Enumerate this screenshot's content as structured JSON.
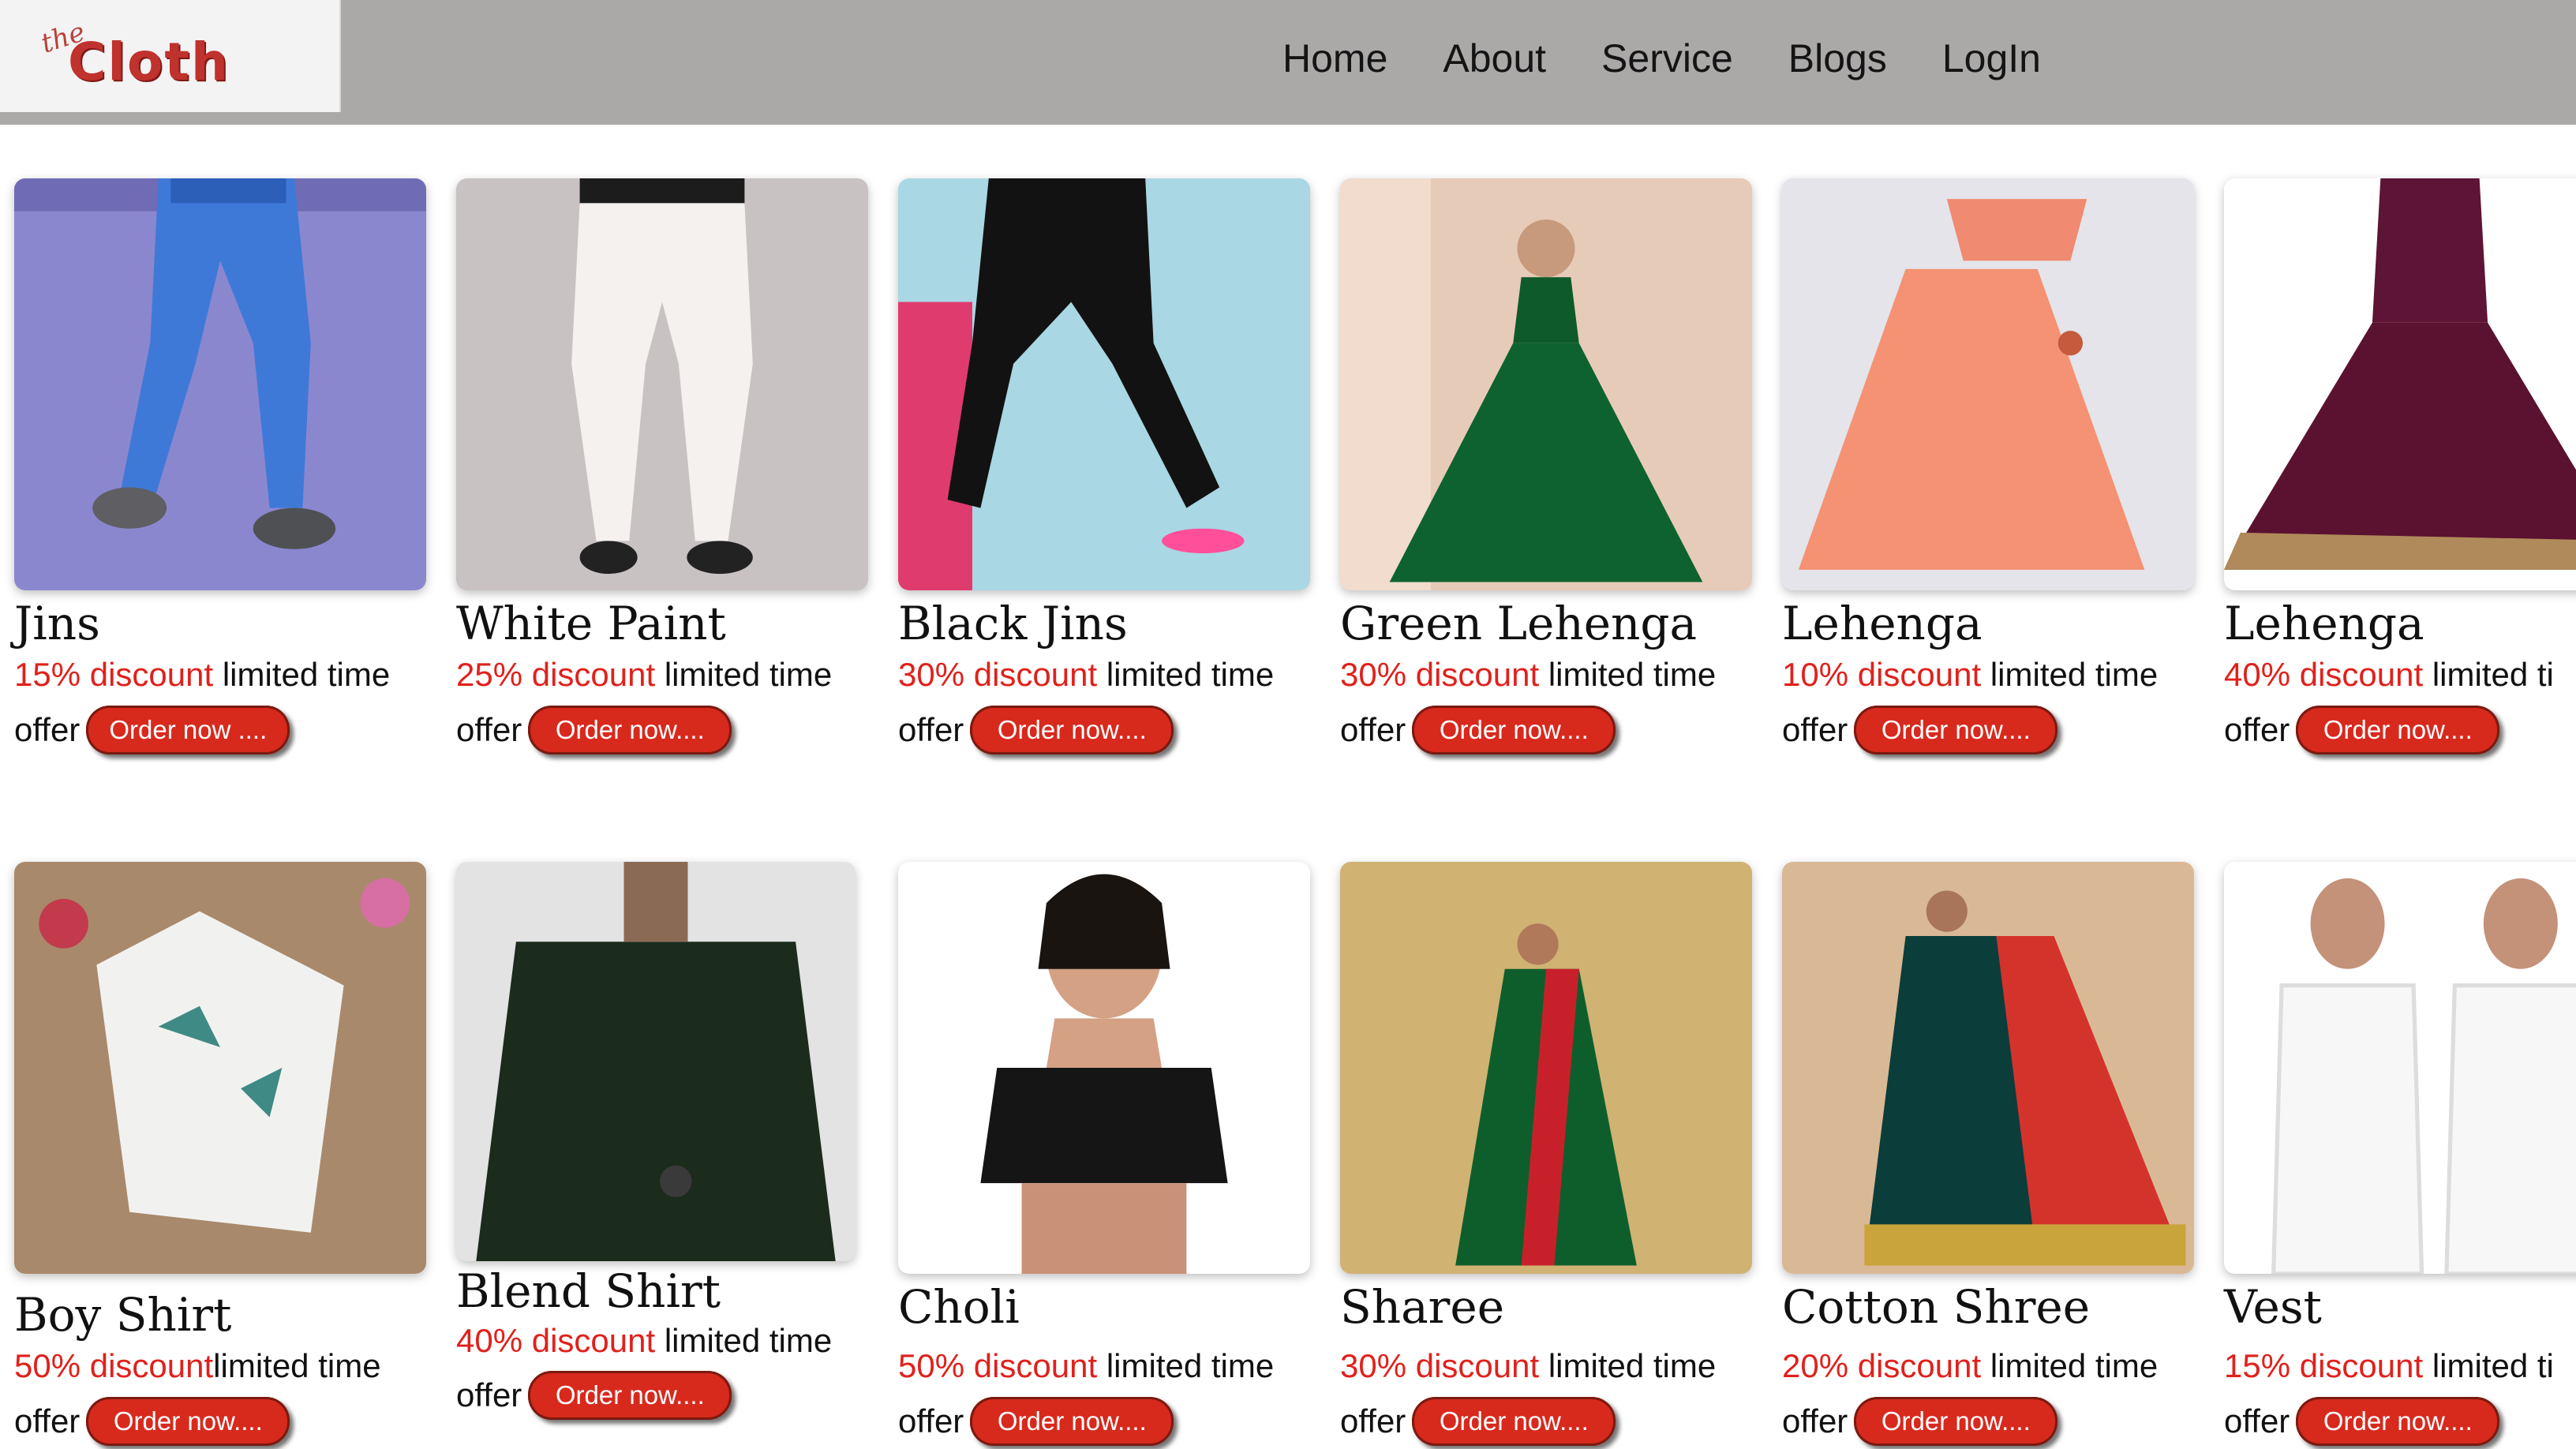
{
  "brand": {
    "logo_small": "the",
    "logo_word": "Cloth"
  },
  "nav": [
    "Home",
    "About",
    "Service",
    "Blogs",
    "LogIn"
  ],
  "colors": {
    "header_bg": "#aba8a8",
    "discount": "#e0211c",
    "button": "#d8291d"
  },
  "products": [
    {
      "name": "Jins",
      "discount": "15% discount",
      "tail": " limited time",
      "offer": "offer",
      "button": "Order now ...."
    },
    {
      "name": "White Paint",
      "discount": "25% discount",
      "tail": " limited time",
      "offer": "offer",
      "button": "Order now...."
    },
    {
      "name": "Black Jins",
      "discount": "30% discount",
      "tail": " limited time",
      "offer": "offer",
      "button": "Order now...."
    },
    {
      "name": "Green Lehenga",
      "discount": "30% discount",
      "tail": " limited time",
      "offer": "offer",
      "button": "Order now...."
    },
    {
      "name": "Lehenga",
      "discount": "10% discount",
      "tail": " limited time",
      "offer": "offer",
      "button": "Order now...."
    },
    {
      "name": "Lehenga",
      "discount": "40% discount",
      "tail": " limited ti",
      "offer": "offer",
      "button": "Order now...."
    },
    {
      "name": "Boy Shirt",
      "discount": "50% discount",
      "tail": "limited time",
      "offer": "offer",
      "button": "Order now...."
    },
    {
      "name": "Blend Shirt",
      "discount": "40% discount",
      "tail": " limited time",
      "offer": "offer",
      "button": "Order now...."
    },
    {
      "name": "Choli",
      "discount": "50% discount",
      "tail": " limited time",
      "offer": "offer",
      "button": "Order now...."
    },
    {
      "name": "Sharee",
      "discount": "30% discount",
      "tail": " limited time",
      "offer": "offer",
      "button": "Order now...."
    },
    {
      "name": "Cotton Shree",
      "discount": "20% discount",
      "tail": " limited time",
      "offer": "offer",
      "button": "Order now...."
    },
    {
      "name": "Vest",
      "discount": "15% discount",
      "tail": " limited ti",
      "offer": "offer",
      "button": "Order now...."
    }
  ]
}
